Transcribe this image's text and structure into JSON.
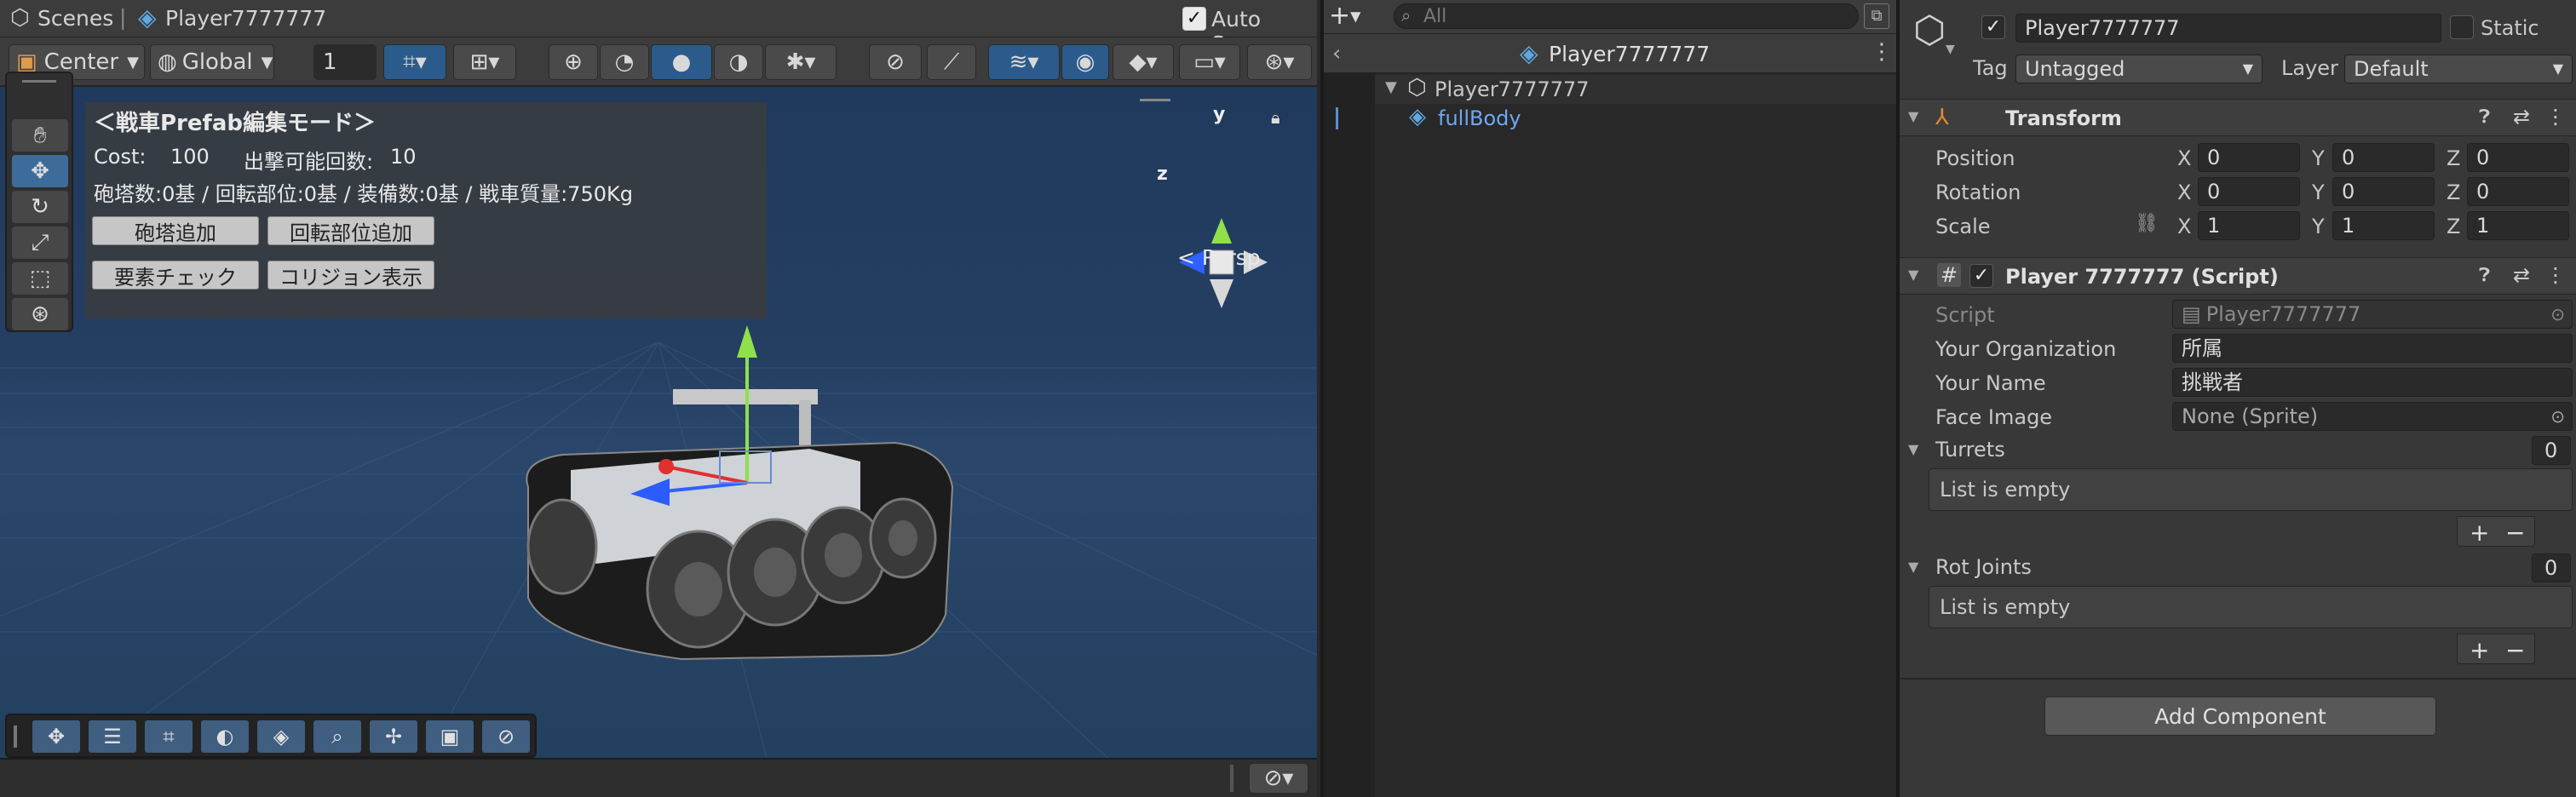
{
  "scene": {
    "breadcrumb": {
      "root": "Scenes",
      "prefab": "Player7777777"
    },
    "auto_save_label": "Auto Save",
    "pivot_label": "Center",
    "space_label": "Global",
    "grid_size": "1",
    "perspective_label": "< Persp",
    "gizmo_y": "y",
    "gizmo_z": "z",
    "overlay": {
      "title": "＜戦車Prefab編集モード＞",
      "cost_label": "Cost:",
      "cost_value": "100",
      "sorties_label": "出撃可能回数:",
      "sorties_value": "10",
      "stats": "砲塔数:0基 / 回転部位:0基 / 装備数:0基 / 戦車質量:750Kg",
      "add_turret": "砲塔追加",
      "add_rotation": "回転部位追加",
      "check_elements": "要素チェック",
      "show_collision": "コリジョン表示"
    }
  },
  "hierarchy": {
    "search_placeholder": "All",
    "header_title": "Player7777777",
    "items": [
      {
        "label": "Player7777777"
      },
      {
        "label": "fullBody"
      }
    ]
  },
  "inspector": {
    "object_name": "Player7777777",
    "static_label": "Static",
    "tag_label": "Tag",
    "tag_value": "Untagged",
    "layer_label": "Layer",
    "layer_value": "Default",
    "transform": {
      "title": "Transform",
      "position_label": "Position",
      "rotation_label": "Rotation",
      "scale_label": "Scale",
      "axis_x": "X",
      "axis_y": "Y",
      "axis_z": "Z",
      "position": [
        "0",
        "0",
        "0"
      ],
      "rotation": [
        "0",
        "0",
        "0"
      ],
      "scale": [
        "1",
        "1",
        "1"
      ]
    },
    "script_component": {
      "title": "Player 7777777 (Script)",
      "script_label": "Script",
      "script_value": "Player7777777",
      "org_label": "Your Organization",
      "org_value": "所属",
      "name_label": "Your Name",
      "name_value": "挑戦者",
      "face_label": "Face Image",
      "face_value": "None (Sprite)",
      "turrets_label": "Turrets",
      "turrets_count": "0",
      "turrets_empty": "List is empty",
      "rot_joints_label": "Rot Joints",
      "rot_joints_count": "0",
      "rot_joints_empty": "List is empty",
      "add_label": "+",
      "remove_label": "−"
    },
    "add_component_label": "Add Component"
  },
  "colors": {
    "accent_blue": "#3e6c9a",
    "panel_dark": "#282828",
    "panel_mid": "#383838",
    "viewport_blue": "#253f62"
  }
}
